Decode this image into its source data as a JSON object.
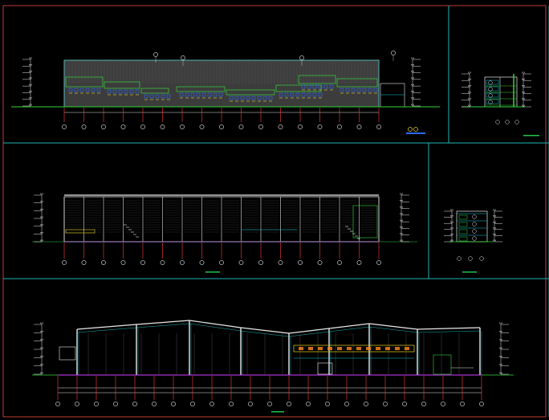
{
  "drawing": {
    "background": "#000000",
    "colors": {
      "outer_border": "#c23a3a",
      "panel_border": "#1fb4b4",
      "outline": "#e8e8e8",
      "axis": "#ff3b3b",
      "grid_bubble": "#e8e8e8",
      "green": "#35d43a",
      "yellow": "#e8d21a",
      "cyan": "#19c9d8",
      "magenta": "#d23cff",
      "blue": "#2d6bff",
      "orange": "#ff8a1a",
      "fill": "#3c3c3c",
      "title_bar": "#1fc44a"
    },
    "panels": [
      {
        "id": "north-elevation",
        "kind": "elevation",
        "bays": 16
      },
      {
        "id": "side-elevation-small",
        "kind": "elevation-small"
      },
      {
        "id": "longitudinal-section",
        "kind": "section",
        "bays": 16
      },
      {
        "id": "side-section-small",
        "kind": "section-small"
      },
      {
        "id": "cross-section",
        "kind": "cross-section",
        "bays": 22
      }
    ]
  }
}
